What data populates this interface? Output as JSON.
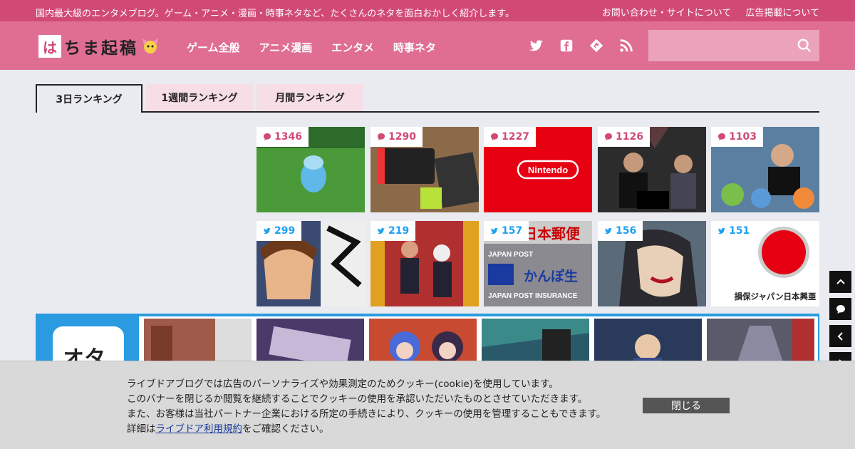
{
  "topbar": {
    "tagline": "国内最大級のエンタメブログ。ゲーム・アニメ・漫画・時事ネタなど、たくさんのネタを面白おかしく紹介します。",
    "links": [
      "お問い合わせ・サイトについて",
      "広告掲載について"
    ]
  },
  "logo": {
    "first": "は",
    "rest": "ちま起稿"
  },
  "nav": [
    "ゲーム全般",
    "アニメ漫画",
    "エンタメ",
    "時事ネタ"
  ],
  "search": {
    "placeholder": ""
  },
  "tabs": [
    "3日ランキング",
    "1週間ランキング",
    "月間ランキング"
  ],
  "ranking": {
    "comments": [
      {
        "count": "1346",
        "color": "#4a9a3a"
      },
      {
        "count": "1290",
        "color": "#8a6a48"
      },
      {
        "count": "1227",
        "color": "#e60012",
        "label": "Nintendo"
      },
      {
        "count": "1126",
        "color": "#2c2c2c"
      },
      {
        "count": "1103",
        "color": "#5a7fa0"
      }
    ],
    "tweets": [
      {
        "count": "299",
        "color": "#3a4a70"
      },
      {
        "count": "219",
        "color": "#b03030"
      },
      {
        "count": "157",
        "color": "#8a8a90",
        "label1": "日本郵便",
        "label2": "JAPAN POST",
        "label3": "かんぽ生",
        "label4": "JAPAN POST INSURANCE"
      },
      {
        "count": "156",
        "color": "#5a6a78"
      },
      {
        "count": "151",
        "color": "#ffffff",
        "label": "損保ジャパン日本興亜"
      }
    ]
  },
  "ota": {
    "icon_text": "オタ"
  },
  "cookie": {
    "line1": "ライブドアブログでは広告のパーソナライズや効果測定のためクッキー(cookie)を使用しています。",
    "line2": "このバナーを閉じるか閲覧を継続することでクッキーの使用を承認いただいたものとさせていただきます。",
    "line3": "また、お客様は当社パートナー企業における所定の手続きにより、クッキーの使用を管理することもできます。",
    "line4_pre": "詳細は",
    "line4_link": "ライブドア利用規約",
    "line4_post": "をご確認ください。",
    "close": "閉じる"
  },
  "colors": {
    "brand": "#d14a76",
    "header": "#e06e93",
    "twitter": "#1da1f2",
    "ota_blue": "#2a9be0"
  }
}
